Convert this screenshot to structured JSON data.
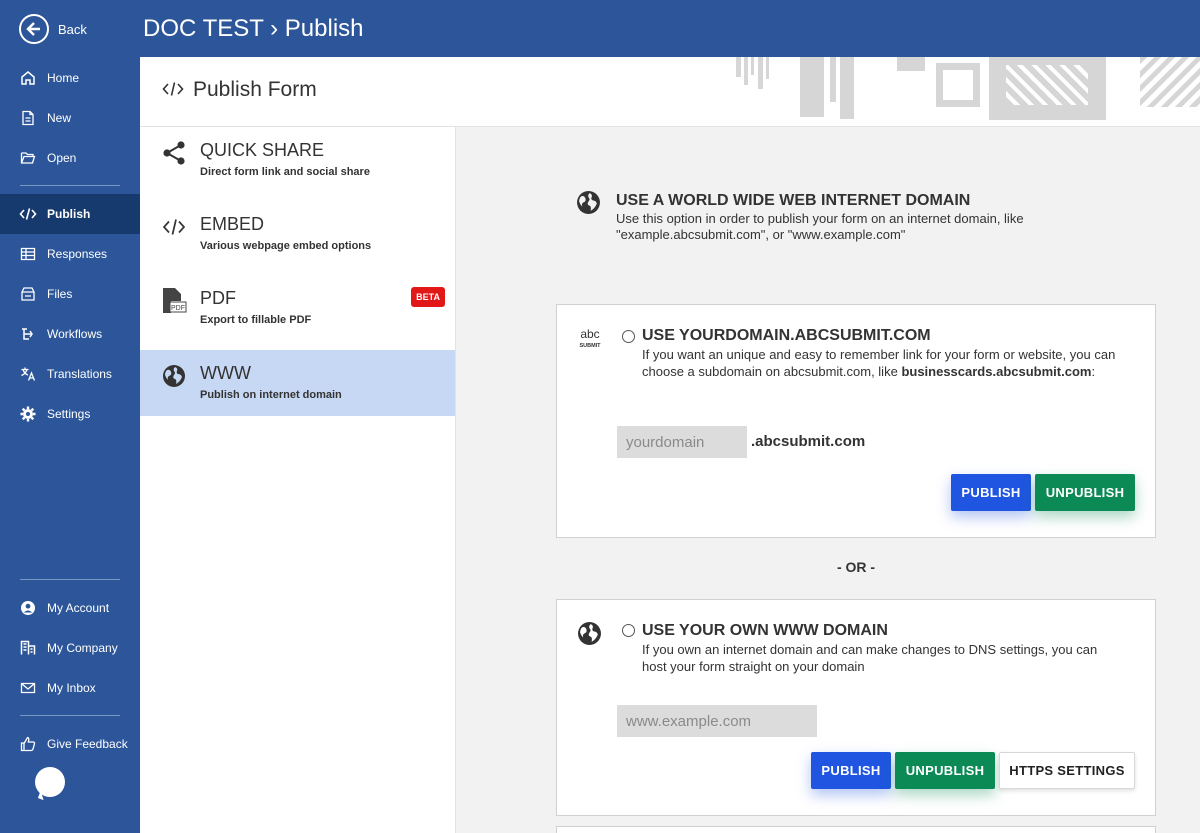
{
  "sidebar": {
    "back_label": "Back",
    "items": [
      {
        "label": "Home",
        "icon": "home-icon"
      },
      {
        "label": "New",
        "icon": "file-icon"
      },
      {
        "label": "Open",
        "icon": "folder-open-icon"
      },
      {
        "label": "Publish",
        "icon": "code-icon"
      },
      {
        "label": "Responses",
        "icon": "table-icon"
      },
      {
        "label": "Files",
        "icon": "storage-icon"
      },
      {
        "label": "Workflows",
        "icon": "workflow-icon"
      },
      {
        "label": "Translations",
        "icon": "translate-icon"
      },
      {
        "label": "Settings",
        "icon": "gear-icon"
      }
    ],
    "account_items": [
      {
        "label": "My Account",
        "icon": "user-icon"
      },
      {
        "label": "My Company",
        "icon": "building-icon"
      },
      {
        "label": "My Inbox",
        "icon": "mail-icon"
      }
    ],
    "feedback_label": "Give Feedback"
  },
  "topbar": {
    "title": "DOC TEST › Publish"
  },
  "header": {
    "title": "Publish Form"
  },
  "options": [
    {
      "title": "QUICK SHARE",
      "subtitle": "Direct form link and social share"
    },
    {
      "title": "EMBED",
      "subtitle": "Various webpage embed options"
    },
    {
      "title": "PDF",
      "subtitle": "Export to fillable PDF",
      "badge": "BETA"
    },
    {
      "title": "WWW",
      "subtitle": "Publish on internet domain"
    }
  ],
  "main": {
    "title": "USE A WORLD WIDE WEB INTERNET DOMAIN",
    "description": "Use this option in order to publish your form on an internet domain, like \"example.abcsubmit.com\", or \"www.example.com\"",
    "subdomain_card": {
      "title": "USE YOURDOMAIN.ABCSUBMIT.COM",
      "desc_prefix": "If you want an unique and easy to remember link for your form or website, you can choose a subdomain on abcsubmit.com, like",
      "desc_example": "businesscards.abcsubmit.com",
      "desc_suffix": ":",
      "logo_top": "abc",
      "logo_bottom": "SUBMIT",
      "input_placeholder": "yourdomain",
      "suffix": ".abcsubmit.com",
      "publish_label": "PUBLISH",
      "unpublish_label": "UNPUBLISH"
    },
    "or_label": "- OR -",
    "own_domain_card": {
      "title": "USE YOUR OWN WWW DOMAIN",
      "description": "If you own an internet domain and can make changes to DNS settings, you can host your form straight on your domain",
      "input_placeholder": "www.example.com",
      "publish_label": "PUBLISH",
      "unpublish_label": "UNPUBLISH",
      "https_label": "HTTPS SETTINGS"
    }
  },
  "colors": {
    "sidebar_bg": "#2c5699",
    "sidebar_active": "#173a6e",
    "option_active": "#c6d8f3",
    "publish": "#1f55e0",
    "unpublish": "#0b8a55",
    "beta": "#e21717"
  }
}
